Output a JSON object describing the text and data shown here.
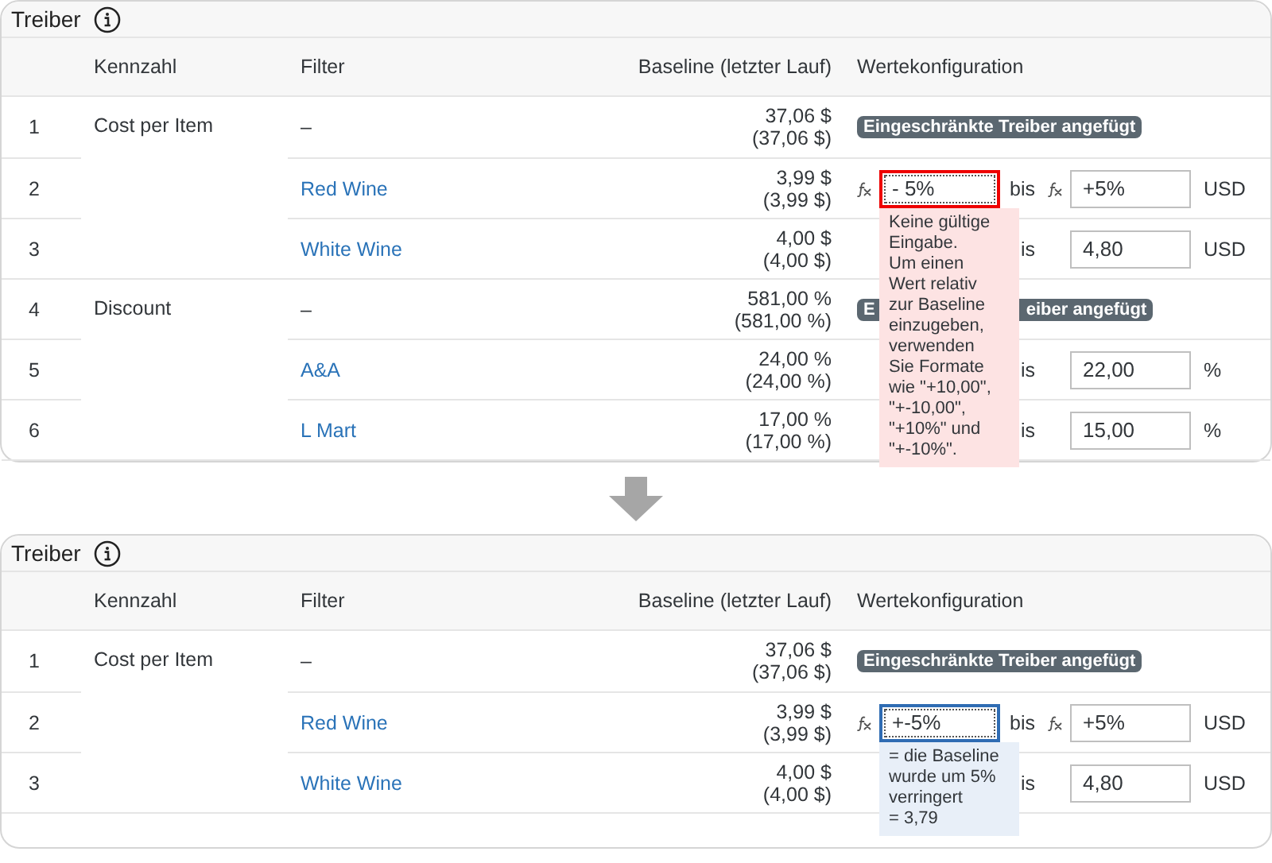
{
  "panels": [
    {
      "title": "Treiber",
      "columns": [
        "Kennzahl",
        "Filter",
        "Baseline (letzter Lauf)",
        "Wertekonfiguration"
      ],
      "rows": [
        {
          "number": "1",
          "measure": "Cost per Item",
          "filter": {
            "kind": "plain",
            "text": "–"
          },
          "baseline": [
            "37,06 $",
            "(37,06 $)"
          ],
          "config": {
            "kind": "badge",
            "parts": [
              "Eingeschränkte Treiber angefügt"
            ]
          }
        },
        {
          "number": "2",
          "filter": {
            "kind": "link",
            "text": "Red Wine"
          },
          "baseline": [
            "3,99 $",
            "(3,99 $)"
          ],
          "config": {
            "kind": "range",
            "from": {
              "fx": true,
              "value": "- 5%",
              "invalid": true,
              "focused": true,
              "message": "Keine gültige\nEingabe.\nUm einen\nWert relativ\nzur Baseline\neinzugeben,\nverwenden\nSie Formate\nwie \"+10,00\",\n\"+-10,00\",\n\"+10%\" und\n\"+-10%\"."
            },
            "between": "bis",
            "to": {
              "fx": true,
              "value": "+5%"
            },
            "unit": "USD"
          }
        },
        {
          "number": "3",
          "filter": {
            "kind": "link",
            "text": "White Wine"
          },
          "baseline": [
            "4,00 $",
            "(4,00 $)"
          ],
          "config": {
            "kind": "range",
            "between": "is",
            "to": {
              "fx": false,
              "value": "4,80"
            },
            "unit": "USD"
          }
        },
        {
          "number": "4",
          "measure": "Discount",
          "filter": {
            "kind": "plain",
            "text": "–"
          },
          "baseline": [
            "581,00 %",
            "(581,00 %)"
          ],
          "config": {
            "kind": "badge",
            "parts": [
              "E",
              "eiber angefügt"
            ]
          }
        },
        {
          "number": "5",
          "filter": {
            "kind": "link",
            "text": "A&A"
          },
          "baseline": [
            "24,00 %",
            "(24,00 %)"
          ],
          "config": {
            "kind": "range",
            "between": "is",
            "to": {
              "fx": false,
              "value": "22,00"
            },
            "unit": "%"
          }
        },
        {
          "number": "6",
          "filter": {
            "kind": "link",
            "text": "L Mart"
          },
          "baseline": [
            "17,00 %",
            "(17,00 %)"
          ],
          "config": {
            "kind": "range",
            "between": "is",
            "to": {
              "fx": false,
              "value": "15,00"
            },
            "unit": "%"
          }
        }
      ]
    },
    {
      "title": "Treiber",
      "columns": [
        "Kennzahl",
        "Filter",
        "Baseline (letzter Lauf)",
        "Wertekonfiguration"
      ],
      "rows": [
        {
          "number": "1",
          "measure": "Cost per Item",
          "filter": {
            "kind": "plain",
            "text": "–"
          },
          "baseline": [
            "37,06 $",
            "(37,06 $)"
          ],
          "config": {
            "kind": "badge",
            "parts": [
              "Eingeschränkte Treiber angefügt"
            ]
          }
        },
        {
          "number": "2",
          "filter": {
            "kind": "link",
            "text": "Red Wine"
          },
          "baseline": [
            "3,99 $",
            "(3,99 $)"
          ],
          "config": {
            "kind": "range",
            "from": {
              "fx": true,
              "value": "+-5%",
              "invalid": false,
              "focused": true,
              "message": "= die Baseline\nwurde um 5%\nverringert\n= 3,79"
            },
            "between": "bis",
            "to": {
              "fx": true,
              "value": "+5%"
            },
            "unit": "USD"
          }
        },
        {
          "number": "3",
          "filter": {
            "kind": "link",
            "text": "White Wine"
          },
          "baseline": [
            "4,00 $",
            "(4,00 $)"
          ],
          "config": {
            "kind": "range",
            "between": "is",
            "to": {
              "fx": false,
              "value": "4,80"
            },
            "unit": "USD"
          }
        }
      ]
    }
  ]
}
